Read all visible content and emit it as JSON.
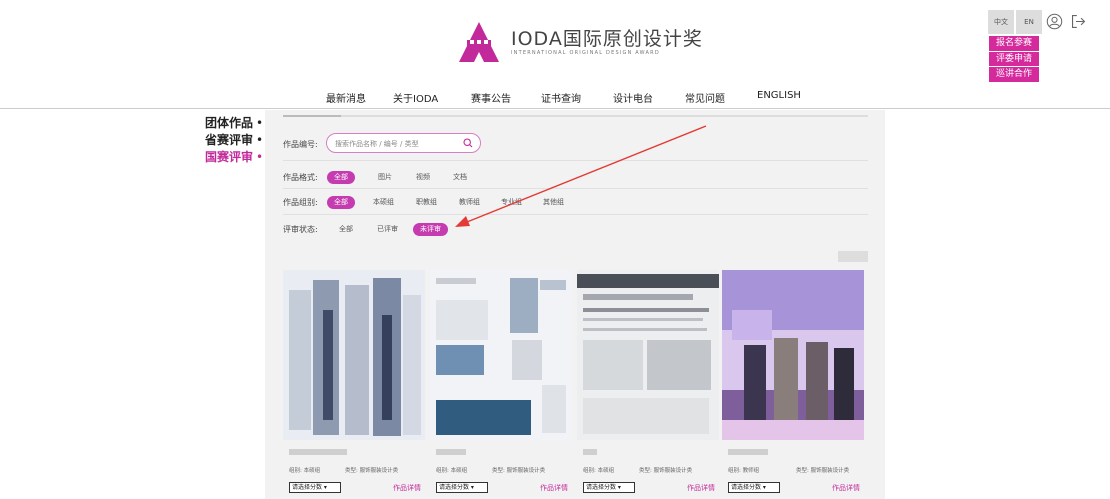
{
  "header": {
    "logo_cn": "IODA国际原创设计奖",
    "logo_en": "INTERNATIONAL ORIGINAL DESIGN AWARD",
    "lang_cn": "中文",
    "lang_en": "EN",
    "actions": [
      "报名参赛",
      "评委申请",
      "巡讲合作"
    ],
    "brand_color": "#c2299a"
  },
  "nav": {
    "items": [
      "最新消息",
      "关于IODA",
      "赛事公告",
      "证书查询",
      "设计电台",
      "常见问题",
      "ENGLISH"
    ]
  },
  "side_menu": {
    "items": [
      {
        "label": "团体作品",
        "active": false
      },
      {
        "label": "省赛评审",
        "active": false
      },
      {
        "label": "国赛评审",
        "active": true
      }
    ],
    "bullet": "•"
  },
  "filters": {
    "work_no_label": "作品编号:",
    "search_placeholder": "搜索作品名称 / 编号 / 类型",
    "format_label": "作品格式:",
    "format_options": [
      "全部",
      "图片",
      "视频",
      "文档"
    ],
    "group_label": "作品组别:",
    "group_options": [
      "全部",
      "本硕组",
      "职教组",
      "教师组",
      "专业组",
      "其他组"
    ],
    "status_label": "评审状态:",
    "status_options": [
      "全部",
      "已评审",
      "未评审"
    ]
  },
  "cards": [
    {
      "group": "组别: 本硕组",
      "type": "类型: 服饰服装设计类",
      "select": "请选择分数",
      "detail": "作品详情"
    },
    {
      "group": "组别: 本硕组",
      "type": "类型: 服饰服装设计类",
      "select": "请选择分数",
      "detail": "作品详情"
    },
    {
      "group": "组别: 本硕组",
      "type": "类型: 服饰服装设计类",
      "select": "请选择分数",
      "detail": "作品详情"
    },
    {
      "group": "组别: 教师组",
      "type": "类型: 服饰服装设计类",
      "select": "请选择分数",
      "detail": "作品详情"
    }
  ]
}
